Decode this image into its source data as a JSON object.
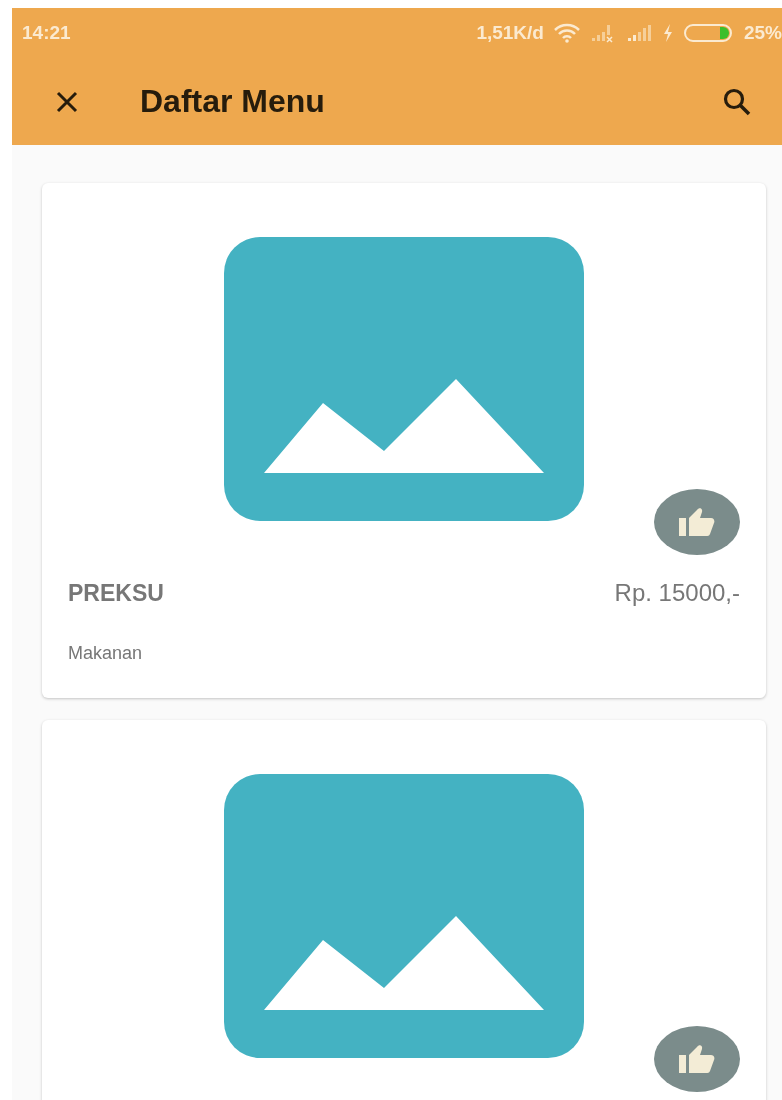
{
  "status_bar": {
    "time": "14:21",
    "speed": "1,51K/d",
    "battery": "25%"
  },
  "toolbar": {
    "title": "Daftar Menu"
  },
  "items": [
    {
      "kind": "full",
      "name": "PREKSU",
      "price": "Rp. 15000,-",
      "category": "Makanan"
    },
    {
      "kind": "image_only"
    }
  ]
}
